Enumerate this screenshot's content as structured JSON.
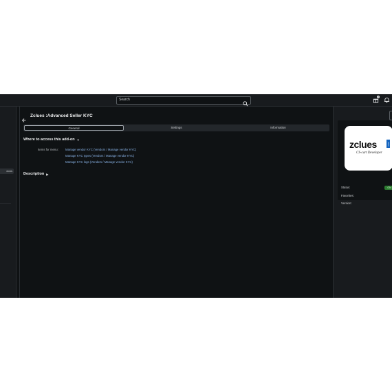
{
  "topbar": {
    "search_placeholder": "Search",
    "icons": [
      "search-icon",
      "gift-icon",
      "bell-icon"
    ],
    "gift_badge": "2"
  },
  "sidebar": {
    "active_item_label": "dons"
  },
  "page": {
    "title": "Zclues :Advanced Seller KYC"
  },
  "tabs": [
    {
      "label": "General",
      "active": true
    },
    {
      "label": "Settings",
      "active": false
    },
    {
      "label": "Information",
      "active": false
    }
  ],
  "access": {
    "heading": "Where to access this add-on",
    "items_label": "Items for menu:",
    "links": [
      "Manage vendor KYC (Vendors / Manage vendor KYC)",
      "Manage KYC types (Vendors / Manage vendor KYC)",
      "Manage KYC logs (Vendors / Manage vendor KYC)"
    ]
  },
  "description": {
    "heading": "Description"
  },
  "addon_panel": {
    "logo_text": "zclues",
    "logo_suffix": ".com",
    "logo_tagline": "CS-cart Developer",
    "status_label": "Status:",
    "status_value": "ON",
    "favorites_label": "Favorites:",
    "version_label": "Version:"
  },
  "colors": {
    "background": "#0f1214",
    "panel": "#181b1e",
    "link": "#8ab4e8",
    "status_on": "#2e7d32"
  }
}
